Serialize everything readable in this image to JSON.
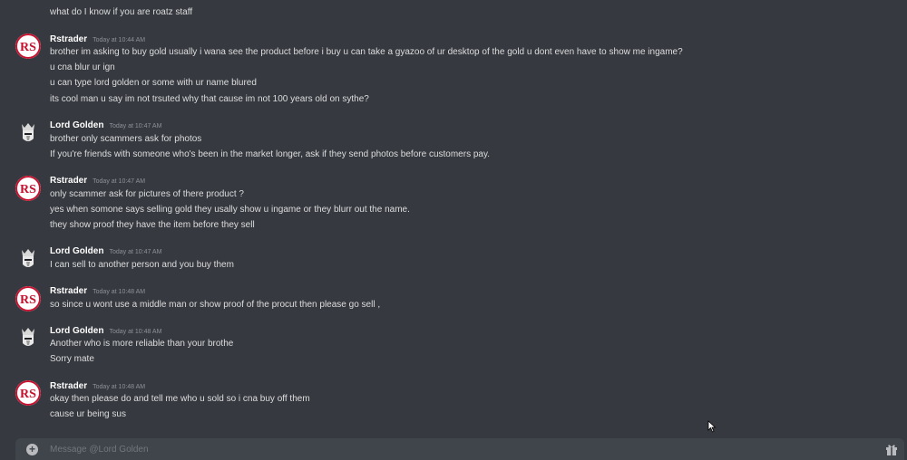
{
  "top_fragment": "what do I know if you are roatz staff",
  "messages": [
    {
      "author": "Rstrader",
      "timestamp": "Today at 10:44 AM",
      "lines": [
        "brother im asking to buy gold usually i wana see the product before i buy u can take a gyazoo of ur desktop of the gold u dont even have to show me ingame?",
        "u cna blur ur ign",
        "u can type lord golden or some with ur name blured",
        "its cool man u say im not trsuted why that cause im not 100 years old on sythe?"
      ]
    },
    {
      "author": "Lord Golden",
      "timestamp": "Today at 10:47 AM",
      "lines": [
        "brother only scammers ask for photos",
        "If you're friends with someone who's been in the market longer, ask if they send photos before customers pay."
      ]
    },
    {
      "author": "Rstrader",
      "timestamp": "Today at 10:47 AM",
      "lines": [
        "only scammer ask for pictures of there product ?",
        "yes when somone says selling gold they usally show u ingame or they blurr out the name.",
        "they show proof they have the item before they sell"
      ]
    },
    {
      "author": "Lord Golden",
      "timestamp": "Today at 10:47 AM",
      "lines": [
        "I can sell to another person and you buy them"
      ]
    },
    {
      "author": "Rstrader",
      "timestamp": "Today at 10:48 AM",
      "lines": [
        "so since u wont use a middle man or show proof of the procut then please go sell ,"
      ]
    },
    {
      "author": "Lord Golden",
      "timestamp": "Today at 10:48 AM",
      "lines": [
        "Another who is more reliable than your brothe",
        "Sorry mate"
      ]
    },
    {
      "author": "Rstrader",
      "timestamp": "Today at 10:48 AM",
      "lines": [
        "okay then please do and tell me who u sold so i cna buy off them",
        "cause ur being sus"
      ]
    }
  ],
  "composer": {
    "placeholder": "Message @Lord Golden",
    "value": ""
  },
  "icons": {
    "attach": "plus-circle-icon",
    "gift": "gift-icon",
    "rstrader_avatar": "rs-logo-avatar",
    "lordgolden_avatar": "knight-helmet-avatar"
  },
  "colors": {
    "background": "#36393f",
    "composer_bg": "#40444b",
    "text": "#dcddde",
    "author": "#ffffff",
    "timestamp": "#8e9297",
    "rs_red": "#c8102e"
  }
}
